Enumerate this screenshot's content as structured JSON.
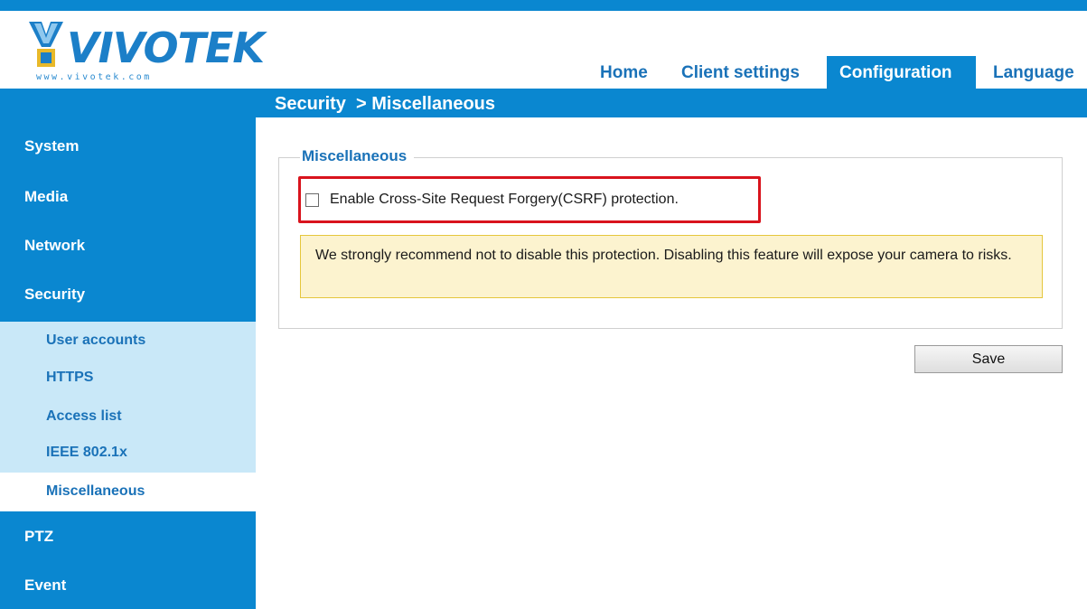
{
  "logo": {
    "brand": "VIVOTEK",
    "url": "www.vivotek.com"
  },
  "tabs": {
    "home": "Home",
    "client_settings": "Client settings",
    "configuration": "Configuration",
    "language": "Language"
  },
  "breadcrumb": "Security  > Miscellaneous",
  "sidebar": {
    "system": "System",
    "media": "Media",
    "network": "Network",
    "security": "Security",
    "security_sub": [
      "User accounts",
      "HTTPS",
      "Access list",
      "IEEE 802.1x",
      "Miscellaneous"
    ],
    "ptz": "PTZ",
    "event": "Event"
  },
  "misc": {
    "legend": "Miscellaneous",
    "csrf_label": "Enable Cross-Site Request Forgery(CSRF) protection.",
    "csrf_checked": false,
    "warning": "We strongly recommend not to disable this protection. Disabling this feature will expose your camera to risks.",
    "save_label": "Save"
  },
  "colors": {
    "primary_blue": "#0a87d0",
    "submenu_bg": "#c9e8f8",
    "highlight_red": "#d9141d",
    "warning_bg": "#fcf3cf"
  }
}
